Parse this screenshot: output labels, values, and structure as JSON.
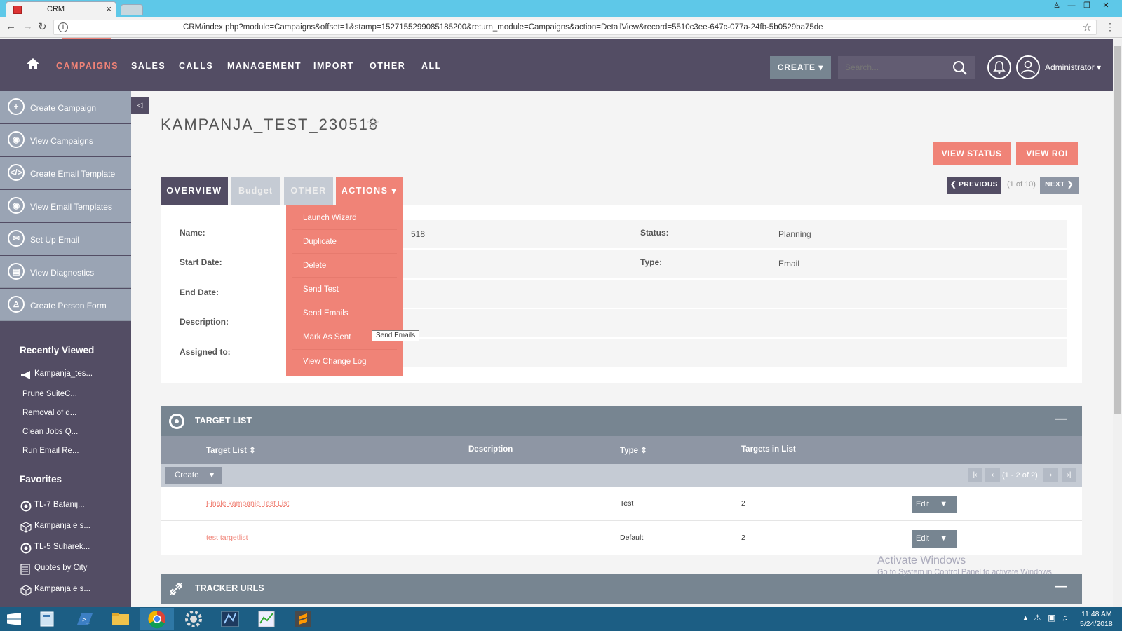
{
  "browser": {
    "tab_title": "CRM",
    "url": "CRM/index.php?module=Campaigns&offset=1&stamp=1527155299085185200&return_module=Campaigns&action=DetailView&record=5510c3ee-647c-077a-24fb-5b0529ba75de"
  },
  "navbar": {
    "items": [
      "CAMPAIGNS",
      "SALES",
      "CALLS",
      "MANAGEMENT",
      "IMPORT",
      "OTHER",
      "ALL"
    ],
    "create_label": "CREATE",
    "search_placeholder": "Search...",
    "user_label": "Administrator"
  },
  "sidebar": {
    "actions": [
      {
        "label": "Create Campaign",
        "icon": "plus-icon"
      },
      {
        "label": "View Campaigns",
        "icon": "eye-icon"
      },
      {
        "label": "Create Email Template",
        "icon": "code-icon"
      },
      {
        "label": "View Email Templates",
        "icon": "eye-icon"
      },
      {
        "label": "Set Up Email",
        "icon": "envelope-icon"
      },
      {
        "label": "View Diagnostics",
        "icon": "clipboard-icon"
      },
      {
        "label": "Create Person Form",
        "icon": "person-icon"
      }
    ],
    "recently_viewed_title": "Recently Viewed",
    "recently_viewed": [
      "Kampanja_tes...",
      "Prune SuiteC...",
      "Removal of d...",
      "Clean Jobs Q...",
      "Run Email Re..."
    ],
    "favorites_title": "Favorites",
    "favorites": [
      "TL-7 Batanij...",
      "Kampanja e s...",
      "TL-5 Suharek...",
      "Quotes by City",
      "Kampanja e s..."
    ]
  },
  "record": {
    "title": "KAMPANJA_TEST_230518",
    "view_status_label": "VIEW STATUS",
    "view_roi_label": "VIEW ROI",
    "prev_label": "PREVIOUS",
    "next_label": "NEXT",
    "pagination": "(1 of 10)"
  },
  "tabs": {
    "overview": "OVERVIEW",
    "budget": "Budget",
    "other": "OTHER",
    "actions": "ACTIONS"
  },
  "fields": {
    "name_label": "Name:",
    "name_value": "518",
    "start_label": "Start Date:",
    "end_label": "End Date:",
    "description_label": "Description:",
    "assigned_label": "Assigned to:",
    "status_label": "Status:",
    "status_value": "Planning",
    "type_label": "Type:",
    "type_value": "Email"
  },
  "actions_menu": {
    "items": [
      "Launch Wizard",
      "Duplicate",
      "Delete",
      "Send Test",
      "Send Emails",
      "Mark As Sent",
      "View Change Log"
    ],
    "tooltip": "Send Emails"
  },
  "target_list": {
    "title": "TARGET LIST",
    "columns": [
      "Target List",
      "Description",
      "Type",
      "Targets in List"
    ],
    "create_label": "Create",
    "range": "(1 - 2 of 2)",
    "rows": [
      {
        "name": "Finale kampanje Test List",
        "type": "Test",
        "count": "2",
        "edit": "Edit"
      },
      {
        "name": "test targetlist",
        "type": "Default",
        "count": "2",
        "edit": "Edit"
      }
    ]
  },
  "tracker": {
    "title": "TRACKER URLS"
  },
  "watermark": {
    "line1": "Activate Windows",
    "line2": "Go to System in Control Panel to activate Windows."
  },
  "taskbar": {
    "time": "11:48 AM",
    "date": "5/24/2018"
  },
  "colors": {
    "accent": "#f08377",
    "nav_bg": "#534d64",
    "panel_bg": "#778591"
  }
}
